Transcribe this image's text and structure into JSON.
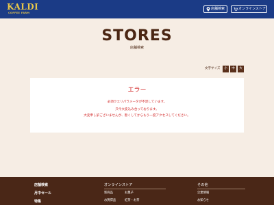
{
  "header": {
    "logo_text": "KALDI",
    "logo_subtext": "COFFEE FARM",
    "store_search_label": "店舗検索",
    "online_store_label": "オンラインストア",
    "background_color": "#1b3b86",
    "logo_color": "#e7c64a"
  },
  "page": {
    "title": "STORES",
    "subtitle": "店舗検索"
  },
  "font_size_control": {
    "label": "文字サイズ",
    "small": "小",
    "medium": "中",
    "large": "大"
  },
  "error": {
    "title": "エラー",
    "lines": [
      "必須クエリパラメータが不足しています。",
      "只今大変込み合っております。",
      "大変申し訳ございませんが、暫くしてからもう一度アクセスしてください。"
    ],
    "color": "#d01e1e"
  },
  "footer": {
    "links": [
      "店舗検索",
      "月中セール",
      "特集"
    ],
    "online_store": {
      "heading": "オンラインストア",
      "items": [
        "新商品",
        "お菓子",
        "お買得品",
        "紅茶・お茶"
      ]
    },
    "other": {
      "heading": "その他",
      "items": [
        "企業情報",
        "お知らせ"
      ]
    },
    "background_color": "#4a2717"
  }
}
